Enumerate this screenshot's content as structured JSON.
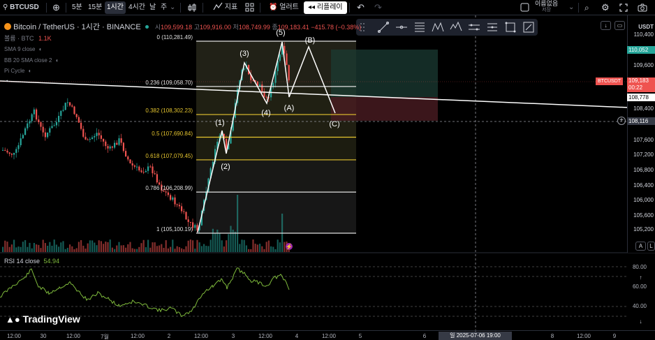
{
  "toolbar": {
    "symbol": "BTCUSD",
    "intervals": [
      "5분",
      "15분",
      "1시간",
      "4시간"
    ],
    "day_label": "날",
    "week_label": "주",
    "indicators_label": "지표",
    "alert_label": "얼러트",
    "replay_label": "리플레이",
    "no_name_label": "이름없음",
    "save_label": "저장"
  },
  "legend": {
    "title": "Bitcoin / TetherUS · 1시간 · BINANCE",
    "o_label": "시",
    "o_value": "109,599.18",
    "h_label": "고",
    "h_value": "109,916.00",
    "l_label": "저",
    "l_value": "108,749.99",
    "c_label": "종",
    "c_value": "109,183.41",
    "change": "−415.78 (−0.38%)",
    "volume_label": "볼륨 · BTC",
    "volume_value": "1.1K",
    "indicators": [
      "SMA 9 close",
      "BB 20 SMA close 2",
      "Pi Cycle"
    ]
  },
  "fib": {
    "levels": [
      {
        "label": "0 (110,281.49)",
        "price": 110281.49,
        "color": "#e0e0e0"
      },
      {
        "label": "0.236 (109,058.70)",
        "price": 109058.7,
        "color": "#e0e0e0"
      },
      {
        "label": "0.382 (108,302.23)",
        "price": 108302.23,
        "color": "#e5c52f"
      },
      {
        "label": "0.5 (107,690.84)",
        "price": 107690.84,
        "color": "#e5c52f"
      },
      {
        "label": "0.618 (107,079.45)",
        "price": 107079.45,
        "color": "#e5c52f"
      },
      {
        "label": "0.786 (106,208.99)",
        "price": 106208.99,
        "color": "#e0e0e0"
      },
      {
        "label": "1 (105,100.19)",
        "price": 105100.19,
        "color": "#e0e0e0"
      }
    ]
  },
  "waves": {
    "labels": [
      "(1)",
      "(2)",
      "(3)",
      "(4)",
      "(5)",
      "(A)",
      "(B)",
      "(C)"
    ]
  },
  "price_axis": {
    "currency": "USDT",
    "ticks": [
      "110,400",
      "109,600",
      "109,200",
      "108,800",
      "108,400",
      "107,600",
      "107,200",
      "106,800",
      "106,400",
      "106,000",
      "105,600",
      "105,200"
    ],
    "tag_top": "110,052",
    "tag_symbol": "BTCUSDT",
    "tag_price": "109,183",
    "tag_countdown": "00:22",
    "tag_line": "108,778",
    "tag_cursor": "108,116"
  },
  "rsi": {
    "label": "RSI 14 close",
    "value": "54.94",
    "levels": [
      "80.00",
      "60.00",
      "40.00"
    ]
  },
  "time_axis": {
    "ticks": [
      "12:00",
      "30",
      "12:00",
      "7월",
      "12:00",
      "2",
      "12:00",
      "3",
      "12:00",
      "4",
      "12:00",
      "5",
      "6",
      "12:00",
      "8",
      "12:00",
      "9"
    ],
    "cursor_label": "일 2025-07-06   19:00"
  },
  "brand": "TradingView",
  "axis_buttons": {
    "auto": "A",
    "log": "L"
  },
  "colors": {
    "up": "#26a69a",
    "down": "#ef5350",
    "fib_white": "#e0e0e0",
    "fib_yellow": "#e5c52f",
    "rsi": "#7fbb3c"
  }
}
